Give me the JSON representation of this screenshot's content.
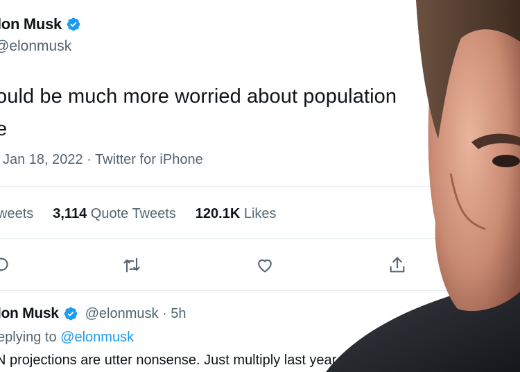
{
  "tweet": {
    "name": "lon Musk",
    "handle": "@elonmusk",
    "text_line1": "ould be much more worried about population",
    "text_line2": "e",
    "date": "Jan 18, 2022 · Twitter for iPhone",
    "stats": [
      {
        "value": "",
        "label": "weets"
      },
      {
        "value": "3,114",
        "label": " Quote Tweets"
      },
      {
        "value": "120.1K",
        "label": " Likes"
      }
    ]
  },
  "reply": {
    "name": "lon Musk",
    "handle_time": "@elonmusk · 5h",
    "replying_prefix": "eplying to ",
    "replying_handle": "@elonmusk",
    "text": "N projections are utter nonsense. Just multiply last year"
  },
  "more_label": "···",
  "icons": [
    "verified-badge-icon",
    "reply-icon",
    "retweet-icon",
    "like-icon",
    "share-icon",
    "more-icon"
  ],
  "colors": {
    "accent": "#1d9bf0",
    "secondary": "#536471",
    "text": "#0f1419"
  }
}
